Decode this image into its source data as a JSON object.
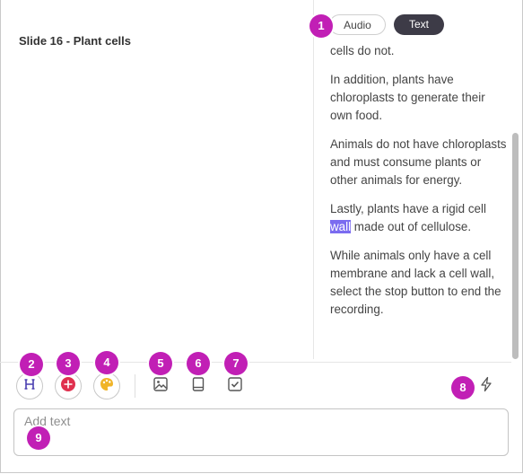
{
  "slide": {
    "title": "Slide 16 - Plant cells"
  },
  "view_toggle": {
    "audio_label": "Audio",
    "text_label": "Text",
    "selected": "Text"
  },
  "transcript": {
    "partial_line": "cells do not.",
    "paragraphs": [
      "In addition, plants have chloroplasts to generate their own food.",
      "Animals do not have chloroplasts and must consume plants or other animals for energy."
    ],
    "highlight_paragraph": {
      "before": "Lastly, plants have a rigid cell ",
      "highlighted": "wall",
      "after": " made out of cellulose."
    },
    "final_paragraph": "While animals only have a cell membrane and lack a cell wall, select the stop button to end the recording."
  },
  "text_input": {
    "placeholder": "Add text",
    "value": ""
  },
  "toolbar": {
    "buttons": [
      {
        "icon": "heading-icon"
      },
      {
        "icon": "record-icon"
      },
      {
        "icon": "palette-icon"
      },
      {
        "icon": "image-icon"
      },
      {
        "icon": "book-icon"
      },
      {
        "icon": "checkbox-icon"
      },
      {
        "icon": "lightning-icon"
      }
    ]
  },
  "callouts": [
    "1",
    "2",
    "3",
    "4",
    "5",
    "6",
    "7",
    "8",
    "9"
  ],
  "colors": {
    "callout": "#c11fb5",
    "highlight": "#7b6cf0",
    "toggle_active": "#3d3b47",
    "heading_icon": "#4a3fb0",
    "record_icon": "#e0304e",
    "palette_icon": "#f0b429"
  }
}
